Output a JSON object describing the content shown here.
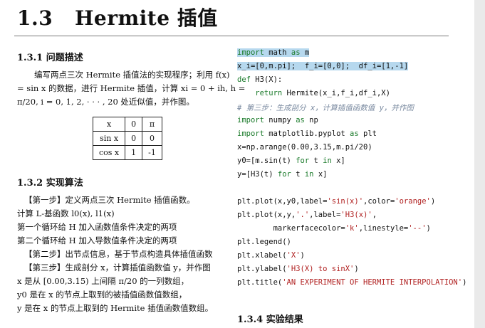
{
  "header": {
    "section_number": "1.3",
    "section_title": "Hermite 插值"
  },
  "subsection1": {
    "title": "1.3.1  问题描述",
    "lines": [
      "编写两点三次 Hermite 插值法的实现程序；利用 f(x)",
      "= sin x 的数据，进行 Hermite 插值，计算 xi = 0 + ih, h =",
      "π/20, i = 0, 1, 2, · · · , 20 处近似值，并作图。"
    ]
  },
  "table": {
    "rows": [
      [
        "x",
        "0",
        "π"
      ],
      [
        "sin x",
        "0",
        "0"
      ],
      [
        "cos x",
        "1",
        "-1"
      ]
    ]
  },
  "subsection2": {
    "title": "1.3.2  实现算法",
    "lines": [
      "【第一步】定义两点三次 Hermite 插值函数。",
      "计算 L-基函数 l0(x), l1(x)",
      "第一个循环给 H 加入函数值条件决定的两项",
      "第二个循环给 H 加入导数值条件决定的两项",
      "【第二步】出节点信息，基于节点构造具体插值函数",
      "【第三步】生成剖分 x，计算插值函数值 y，并作图",
      "x 是从 [0.00,3.15) 上间隔 π/20 的一列数组，",
      "y0 是在 x 的节点上取到的被插值函数值数组，",
      "y 是在 x 的节点上取到的 Hermite 插值函数值数组。"
    ]
  },
  "code": {
    "l1_kw1": "import",
    "l1_mod": " math ",
    "l1_kw2": "as",
    "l1_alias": " m",
    "l2": "x_i=[0,m.pi];  f_i=[0,0];  df_i=[1,-1]",
    "l3_kw": "def",
    "l3_rest": " H3(X):",
    "l4_kw": "    return",
    "l4_rest": " Hermite(x_i,f_i,df_i,X)",
    "l5_comment": "# 第三步：生成剖分 x，计算插值函数值 y，并作图",
    "l6_kw1": "import",
    "l6_mod": " numpy ",
    "l6_kw2": "as",
    "l6_alias": " np",
    "l7_kw1": "import",
    "l7_mod": " matplotlib.pyplot ",
    "l7_kw2": "as",
    "l7_alias": " plt",
    "l8": "x=np.arange(0.00,3.15,m.pi/20)",
    "l9_a": "y0=[m.sin(t) ",
    "l9_for": "for",
    "l9_b": " t ",
    "l9_in": "in",
    "l9_c": " x]",
    "l10_a": "y=[H3(t) ",
    "l10_for": "for",
    "l10_b": " t ",
    "l10_in": "in",
    "l10_c": " x]",
    "l11_a": "plt.plot(x,y0,label=",
    "l11_s1": "'sin(x)'",
    "l11_b": ",color=",
    "l11_s2": "'orange'",
    "l11_c": ")",
    "l12_a": "plt.plot(x,y,",
    "l12_s1": "'.'",
    "l12_b": ",label=",
    "l12_s2": "'H3(x)'",
    "l12_c": ",",
    "l13_a": "        markerfacecolor=",
    "l13_s1": "'k'",
    "l13_b": ",linestyle=",
    "l13_s2": "'--'",
    "l13_c": ")",
    "l14": "plt.legend()",
    "l15_a": "plt.xlabel(",
    "l15_s": "'X'",
    "l15_b": ")",
    "l16_a": "plt.ylabel(",
    "l16_s": "'H3(X) to sinX'",
    "l16_b": ")",
    "l17_a": "plt.title(",
    "l17_s": "'AN EXPERIMENT OF HERMITE INTERPOLATION'",
    "l17_b": ")"
  },
  "subsection4": {
    "title": "1.3.4  实验结果"
  }
}
